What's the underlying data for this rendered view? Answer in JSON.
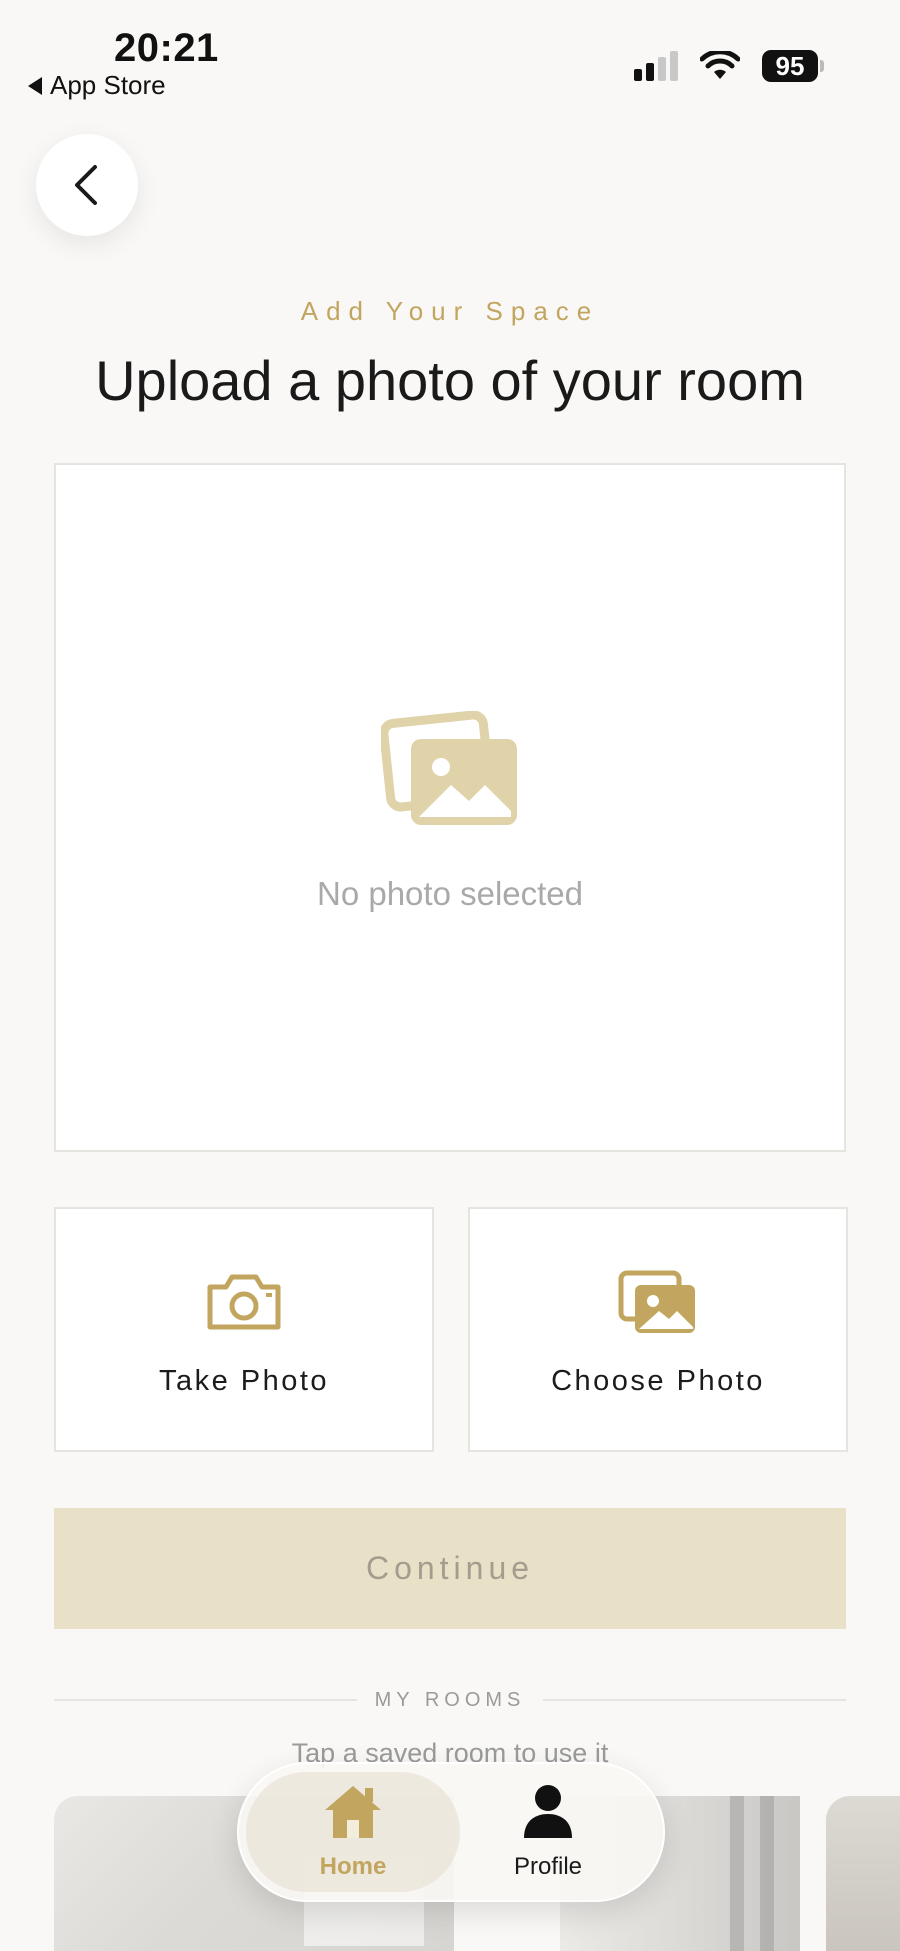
{
  "status_bar": {
    "time": "20:21",
    "back_label": "App Store",
    "battery": "95"
  },
  "header": {
    "eyebrow": "Add Your Space",
    "title": "Upload a photo of your room"
  },
  "preview": {
    "placeholder": "No photo selected"
  },
  "actions": {
    "take_photo": "Take Photo",
    "choose_photo": "Choose Photo"
  },
  "continue_label": "Continue",
  "my_rooms": {
    "heading": "MY ROOMS",
    "hint": "Tap a saved room to use it"
  },
  "tab_bar": {
    "home": "Home",
    "profile": "Profile"
  },
  "colors": {
    "accent": "#c2a65f",
    "continue_bg": "#e8e0c7",
    "background": "#f9f8f6"
  }
}
